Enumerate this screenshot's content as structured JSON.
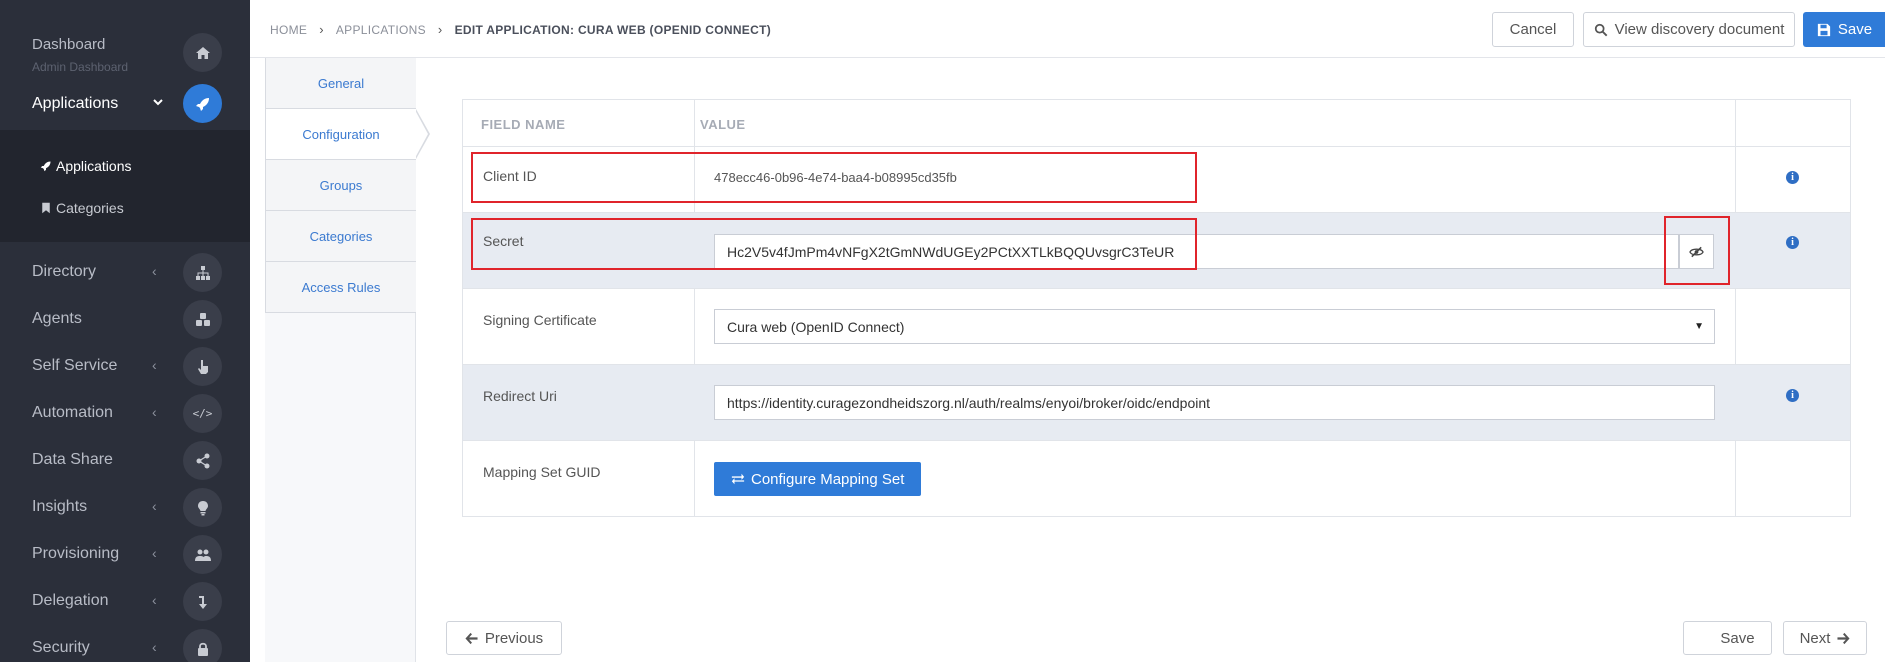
{
  "sidebar": {
    "dashboard": {
      "label": "Dashboard",
      "sub": "Admin Dashboard",
      "icon": "home-icon"
    },
    "applications": {
      "label": "Applications",
      "icon": "rocket-icon",
      "expanded": true
    },
    "submenu": [
      {
        "label": "Applications",
        "icon": "rocket-icon",
        "active": true
      },
      {
        "label": "Categories",
        "icon": "bookmark-icon"
      }
    ],
    "items": [
      {
        "label": "Directory",
        "icon": "sitemap-icon",
        "chevron": true
      },
      {
        "label": "Agents",
        "icon": "cubes-icon",
        "chevron": false
      },
      {
        "label": "Self Service",
        "icon": "hand-pointer-icon",
        "chevron": true
      },
      {
        "label": "Automation",
        "icon": "code-icon",
        "chevron": true
      },
      {
        "label": "Data Share",
        "icon": "share-icon",
        "chevron": false
      },
      {
        "label": "Insights",
        "icon": "lightbulb-icon",
        "chevron": true
      },
      {
        "label": "Provisioning",
        "icon": "users-icon",
        "chevron": true
      },
      {
        "label": "Delegation",
        "icon": "level-down-icon",
        "chevron": true
      },
      {
        "label": "Security",
        "icon": "lock-icon",
        "chevron": true
      }
    ]
  },
  "breadcrumb": {
    "home": "HOME",
    "applications": "APPLICATIONS",
    "current": "EDIT APPLICATION: CURA WEB (OPENID CONNECT)"
  },
  "header": {
    "cancel": "Cancel",
    "discovery": "View discovery document",
    "save": "Save"
  },
  "tabs": [
    {
      "label": "General"
    },
    {
      "label": "Configuration",
      "active": true
    },
    {
      "label": "Groups"
    },
    {
      "label": "Categories"
    },
    {
      "label": "Access Rules"
    }
  ],
  "table": {
    "headers": {
      "field": "FIELD NAME",
      "value": "VALUE"
    },
    "client_id": {
      "label": "Client ID",
      "value": "478ecc46-0b96-4e74-baa4-b08995cd35fb"
    },
    "secret": {
      "label": "Secret",
      "value": "Hc2V5v4fJmPm4vNFgX2tGmNWdUGEy2PCtXXTLkBQQUvsgrC3TeUR"
    },
    "signing_certificate": {
      "label": "Signing Certificate",
      "value": "Cura web (OpenID Connect)"
    },
    "redirect_uri": {
      "label": "Redirect Uri",
      "value": "https://identity.curagezondheidszorg.nl/auth/realms/enyoi/broker/oidc/endpoint"
    },
    "mapping_set": {
      "label": "Mapping Set GUID",
      "button": "Configure Mapping Set"
    }
  },
  "footer": {
    "previous": "Previous",
    "save": "Save",
    "next": "Next"
  },
  "colors": {
    "primary": "#2f7bd8",
    "sidebar": "#2b2f3a",
    "highlight": "#e0242b"
  }
}
